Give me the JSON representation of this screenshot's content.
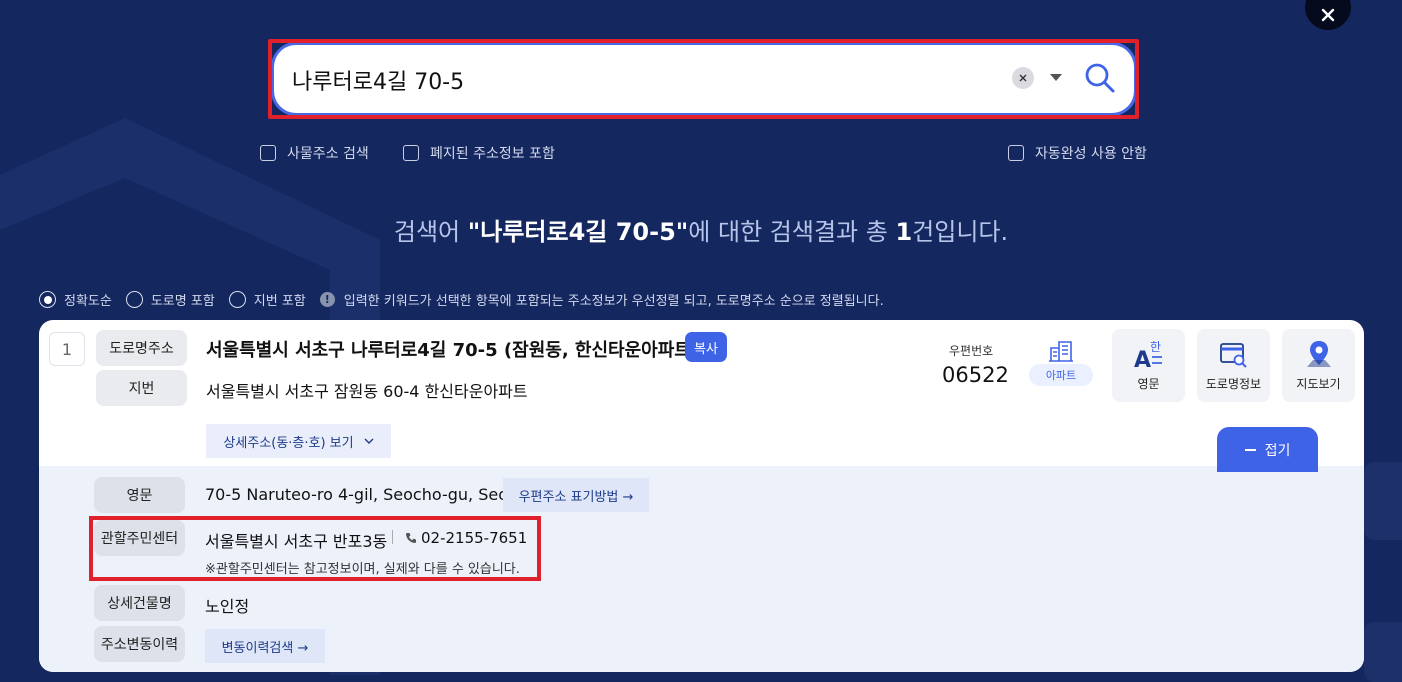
{
  "search": {
    "query": "나루터로4길 70-5",
    "placeholder": ""
  },
  "options": {
    "building_search": "사물주소 검색",
    "include_abolished": "폐지된 주소정보 포함",
    "no_autocomplete": "자동완성 사용 안함"
  },
  "result_summary": {
    "prefix": "검색어 ",
    "keyword": "\"나루터로4길 70-5\"",
    "middle": "에 대한 검색결과 총 ",
    "count": "1",
    "suffix": "건입니다."
  },
  "sort": {
    "accuracy": "정확도순",
    "road_included": "도로명 포함",
    "lot_included": "지번 포함",
    "info_icon": "!",
    "info_text": "입력한 키워드가 선택한 항목에 포함되는 주소정보가 우선정렬 되고, 도로명주소 순으로 정렬됩니다."
  },
  "result": {
    "number": "1",
    "road_label": "도로명주소",
    "road_address": "서울특별시 서초구 나루터로4길 70-5 (잠원동, 한신타운아파트)",
    "copy_label": "복사",
    "lot_label": "지번",
    "lot_address": "서울특별시 서초구 잠원동 60-4 한신타운아파트",
    "zip_label": "우편번호",
    "zip_code": "06522",
    "building_type": "아파트",
    "tools": {
      "english": "영문",
      "road_info": "도로명정보",
      "map": "지도보기"
    },
    "detail_toggle": "상세주소(동·층·호) 보기",
    "fold_label": "접기",
    "detail": {
      "english_label": "영문",
      "english_address": "70-5 Naruteo-ro 4-gil, Seocho-gu, Seoul",
      "postal_notation": "우편주소 표기방법 →",
      "center_label": "관할주민센터",
      "center_name": "서울특별시 서초구 반포3동",
      "center_phone": "02-2155-7651",
      "center_note": "※관할주민센터는 참고정보이며, 실제와 다를 수 있습니다.",
      "building_label": "상세건물명",
      "building_name": "노인정",
      "history_label": "주소변동이력",
      "history_button": "변동이력검색 →"
    }
  },
  "colors": {
    "background": "#14275e",
    "accent": "#3f63e7",
    "highlight": "#e0202a"
  }
}
